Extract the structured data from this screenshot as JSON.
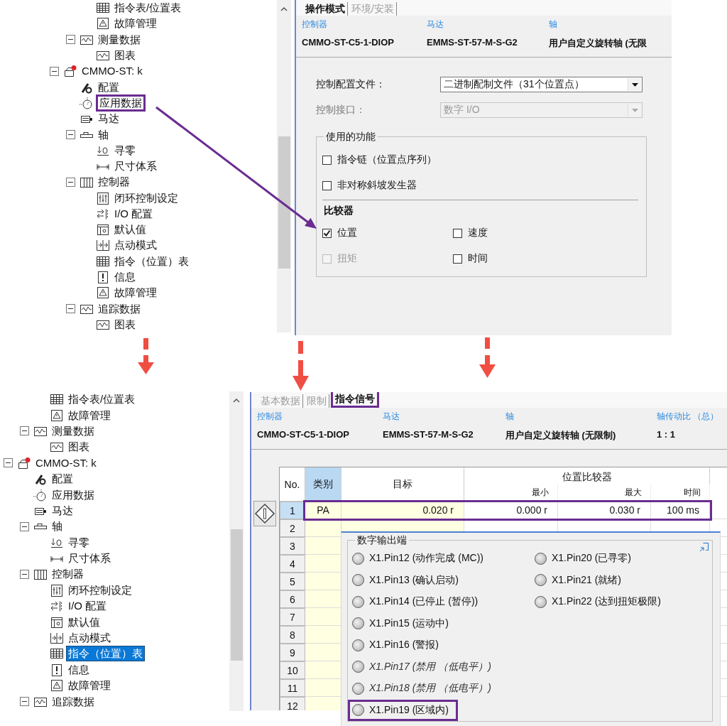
{
  "top_screenshot": {
    "tree": [
      {
        "children": [
          {
            "children": [
              {
                "label": "指令表/位置表",
                "kind": "table",
                "selected": false,
                "highlighted": false
              },
              {
                "label": "故障管理",
                "kind": "warning",
                "selected": false,
                "highlighted": false
              }
            ]
          },
          {
            "label": "测量数据",
            "kind": "chart",
            "expanded": true,
            "selected": false,
            "highlighted": false,
            "children": [
              {
                "label": "图表",
                "kind": "chart",
                "selected": false,
                "highlighted": false
              }
            ]
          }
        ]
      },
      {
        "label": "CMMO-ST: k",
        "kind": "device",
        "expanded": true,
        "selected": false,
        "highlighted": false,
        "children": [
          {
            "label": "配置",
            "kind": "wrench",
            "selected": false,
            "highlighted": false
          },
          {
            "label": "应用数据",
            "kind": "gauge",
            "selected": false,
            "highlighted": true
          },
          {
            "label": "马达",
            "kind": "motor",
            "selected": false,
            "highlighted": false
          },
          {
            "label": "轴",
            "kind": "axis",
            "expanded": true,
            "selected": false,
            "highlighted": false,
            "children": [
              {
                "label": "寻零",
                "kind": "homing",
                "selected": false,
                "highlighted": false
              },
              {
                "label": "尺寸体系",
                "kind": "dimension",
                "selected": false,
                "highlighted": false
              }
            ]
          },
          {
            "label": "控制器",
            "kind": "controller",
            "expanded": true,
            "selected": false,
            "highlighted": false,
            "children": [
              {
                "label": "闭环控制设定",
                "kind": "loop",
                "selected": false,
                "highlighted": false
              },
              {
                "label": "I/O 配置",
                "kind": "io",
                "selected": false,
                "highlighted": false
              },
              {
                "label": "默认值",
                "kind": "defaults",
                "selected": false,
                "highlighted": false
              },
              {
                "label": "点动模式",
                "kind": "jog",
                "selected": false,
                "highlighted": false
              },
              {
                "label": "指令（位置）表",
                "kind": "table",
                "selected": false,
                "highlighted": false
              },
              {
                "label": "信息",
                "kind": "info",
                "selected": false,
                "highlighted": false
              },
              {
                "label": "故障管理",
                "kind": "warning",
                "selected": false,
                "highlighted": false
              }
            ]
          },
          {
            "label": "追踪数据",
            "kind": "chart",
            "expanded": true,
            "selected": false,
            "highlighted": false,
            "children": [
              {
                "label": "图表",
                "kind": "chart",
                "selected": false,
                "highlighted": false
              }
            ]
          }
        ]
      }
    ],
    "tabs": [
      {
        "label": "操作模式",
        "selected": true
      },
      {
        "label": "环境/安装",
        "selected": false
      }
    ],
    "header": [
      {
        "label": "控制器",
        "value": "CMMO-ST-C5-1-DIOP"
      },
      {
        "label": "马达",
        "value": "EMMS-ST-57-M-S-G2"
      },
      {
        "label": "轴",
        "value": "用户自定义旋转轴 (无限"
      }
    ],
    "settings": [
      {
        "label": "控制配置文件：",
        "value": "二进制配制文件（31个位置点）",
        "disabled": false
      },
      {
        "label": "控制接口：",
        "value": "数字 I/O",
        "disabled": true
      }
    ],
    "features": {
      "title": "使用的功能",
      "options": [
        {
          "label": "指令链（位置点序列）",
          "checked": false,
          "disabled": false
        },
        {
          "label": "非对称斜坡发生器",
          "checked": false,
          "disabled": false
        }
      ],
      "comparator_title": "比较器",
      "comparators": [
        {
          "label": "位置",
          "checked": true,
          "disabled": false
        },
        {
          "label": "速度",
          "checked": false,
          "disabled": false
        },
        {
          "label": "扭矩",
          "checked": false,
          "disabled": true
        },
        {
          "label": "时间",
          "checked": false,
          "disabled": false
        }
      ]
    }
  },
  "bottom_screenshot": {
    "tree": [
      {
        "children": [
          {
            "children": [
              {
                "label": "指令表/位置表",
                "kind": "table",
                "selected": false,
                "highlighted": false
              },
              {
                "label": "故障管理",
                "kind": "warning",
                "selected": false,
                "highlighted": false
              }
            ]
          },
          {
            "label": "测量数据",
            "kind": "chart",
            "expanded": true,
            "selected": false,
            "highlighted": false,
            "children": [
              {
                "label": "图表",
                "kind": "chart",
                "selected": false,
                "highlighted": false
              }
            ]
          }
        ]
      },
      {
        "label": "CMMO-ST: k",
        "kind": "device",
        "expanded": true,
        "selected": false,
        "highlighted": false,
        "children": [
          {
            "label": "配置",
            "kind": "wrench",
            "selected": false,
            "highlighted": false
          },
          {
            "label": "应用数据",
            "kind": "gauge",
            "selected": false,
            "highlighted": false
          },
          {
            "label": "马达",
            "kind": "motor",
            "selected": false,
            "highlighted": false
          },
          {
            "label": "轴",
            "kind": "axis",
            "expanded": true,
            "selected": false,
            "highlighted": false,
            "children": [
              {
                "label": "寻零",
                "kind": "homing",
                "selected": false,
                "highlighted": false
              },
              {
                "label": "尺寸体系",
                "kind": "dimension",
                "selected": false,
                "highlighted": false
              }
            ]
          },
          {
            "label": "控制器",
            "kind": "controller",
            "expanded": true,
            "selected": false,
            "highlighted": false,
            "children": [
              {
                "label": "闭环控制设定",
                "kind": "loop",
                "selected": false,
                "highlighted": false
              },
              {
                "label": "I/O 配置",
                "kind": "io",
                "selected": false,
                "highlighted": false
              },
              {
                "label": "默认值",
                "kind": "defaults",
                "selected": false,
                "highlighted": false
              },
              {
                "label": "点动模式",
                "kind": "jog",
                "selected": false,
                "highlighted": false
              },
              {
                "label": "指令（位置）表",
                "kind": "table",
                "selected": true,
                "highlighted": false
              },
              {
                "label": "信息",
                "kind": "info",
                "selected": false,
                "highlighted": false
              },
              {
                "label": "故障管理",
                "kind": "warning",
                "selected": false,
                "highlighted": false
              }
            ]
          },
          {
            "label": "追踪数据",
            "kind": "chart",
            "expanded": true,
            "selected": false,
            "highlighted": false
          }
        ]
      }
    ],
    "tabs": [
      {
        "label": "基本数据",
        "selected": false,
        "highlighted": false
      },
      {
        "label": "限制",
        "selected": false,
        "highlighted": false
      },
      {
        "label": "指令信号",
        "selected": true,
        "highlighted": true
      }
    ],
    "header": [
      {
        "label": "控制器",
        "value": "CMMO-ST-C5-1-DIOP"
      },
      {
        "label": "马达",
        "value": "EMMS-ST-57-M-S-G2"
      },
      {
        "label": "轴",
        "value": "用户自定义旋转轴 (无限制)"
      },
      {
        "label": "轴传动比 （总）",
        "value": "1 : 1"
      }
    ],
    "table": {
      "group_header": "位置比较器",
      "columns": [
        {
          "label": "No.",
          "kind": "single",
          "selected": false
        },
        {
          "label": "类别",
          "kind": "single",
          "selected": true
        },
        {
          "label": "目标",
          "kind": "single",
          "selected": false
        },
        {
          "label": "最小",
          "kind": "sub",
          "selected": false
        },
        {
          "label": "最大",
          "kind": "sub",
          "selected": false
        },
        {
          "label": "时间",
          "kind": "sub",
          "selected": false
        }
      ],
      "rows": [
        {
          "no": "1",
          "selected": true,
          "highlighted": true,
          "cells": [
            "PA",
            "0.020 r",
            "0.000 r",
            "0.030 r",
            "100 ms"
          ]
        },
        {
          "no": "2",
          "selected": false,
          "highlighted": false
        },
        {
          "no": "3",
          "selected": false,
          "highlighted": false
        },
        {
          "no": "4",
          "selected": false,
          "highlighted": false
        },
        {
          "no": "5",
          "selected": false,
          "highlighted": false
        },
        {
          "no": "6",
          "selected": false,
          "highlighted": false
        },
        {
          "no": "7",
          "selected": false,
          "highlighted": false
        },
        {
          "no": "8",
          "selected": false,
          "highlighted": false
        },
        {
          "no": "9",
          "selected": false,
          "highlighted": false
        },
        {
          "no": "10",
          "selected": false,
          "highlighted": false
        },
        {
          "no": "11",
          "selected": false,
          "highlighted": false
        },
        {
          "no": "12",
          "selected": false,
          "highlighted": false
        }
      ]
    },
    "outputs_panel": {
      "title": "数字输出端",
      "pins": [
        {
          "label": "X1.Pin12 (动作完成 (MC))",
          "on": false,
          "disabled": false,
          "highlighted": false
        },
        {
          "label": "X1.Pin13 (确认启动)",
          "on": false,
          "disabled": false,
          "highlighted": false
        },
        {
          "label": "X1.Pin14 (已停止 (暂停))",
          "on": false,
          "disabled": false,
          "highlighted": false
        },
        {
          "label": "X1.Pin15 (运动中)",
          "on": false,
          "disabled": false,
          "highlighted": false
        },
        {
          "label": "X1.Pin16 (警报)",
          "on": false,
          "disabled": false,
          "highlighted": false
        },
        {
          "label": "X1.Pin17 (禁用 （低电平）)",
          "on": false,
          "disabled": true,
          "highlighted": false
        },
        {
          "label": "X1.Pin18 (禁用 （低电平）)",
          "on": false,
          "disabled": true,
          "highlighted": false
        },
        {
          "label": "X1.Pin19 (区域内)",
          "on": false,
          "disabled": false,
          "highlighted": true
        },
        {
          "label": "X1.Pin20 (已寻零)",
          "on": false,
          "disabled": false,
          "highlighted": false
        },
        {
          "label": "X1.Pin21 (就绪)",
          "on": false,
          "disabled": false,
          "highlighted": false
        },
        {
          "label": "X1.Pin22 (达到扭矩极限)",
          "on": false,
          "disabled": false,
          "highlighted": false
        }
      ]
    }
  }
}
